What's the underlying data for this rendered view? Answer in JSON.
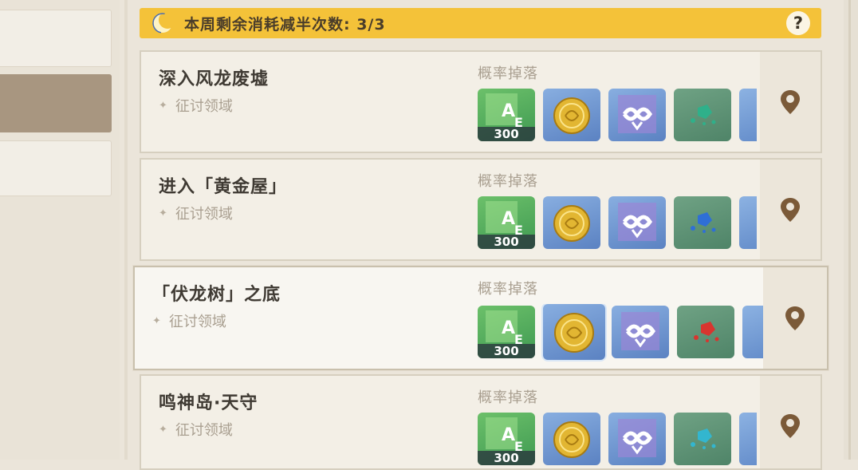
{
  "banner": {
    "icon": "moon-icon",
    "text": "本周剩余消耗减半次数: 3/3",
    "help_label": "?"
  },
  "domains": [
    {
      "title": "深入风龙废墟",
      "subtitle": "征讨领域",
      "drop_label": "概率掉落",
      "exp_count": "300",
      "stone_color": "#2fb08a",
      "selected": false
    },
    {
      "title": "进入「黄金屋」",
      "subtitle": "征讨领域",
      "drop_label": "概率掉落",
      "exp_count": "300",
      "stone_color": "#2f6fd6",
      "selected": false
    },
    {
      "title": "「伏龙树」之底",
      "subtitle": "征讨领域",
      "drop_label": "概率掉落",
      "exp_count": "300",
      "stone_color": "#d8352f",
      "selected": true
    },
    {
      "title": "鸣神岛·天守",
      "subtitle": "征讨领域",
      "drop_label": "概率掉落",
      "exp_count": "300",
      "stone_color": "#33b6cf",
      "selected": false
    }
  ],
  "colors": {
    "banner_bg": "#f4c239",
    "pin": "#7b5a38",
    "active_tab": "#a89680"
  }
}
